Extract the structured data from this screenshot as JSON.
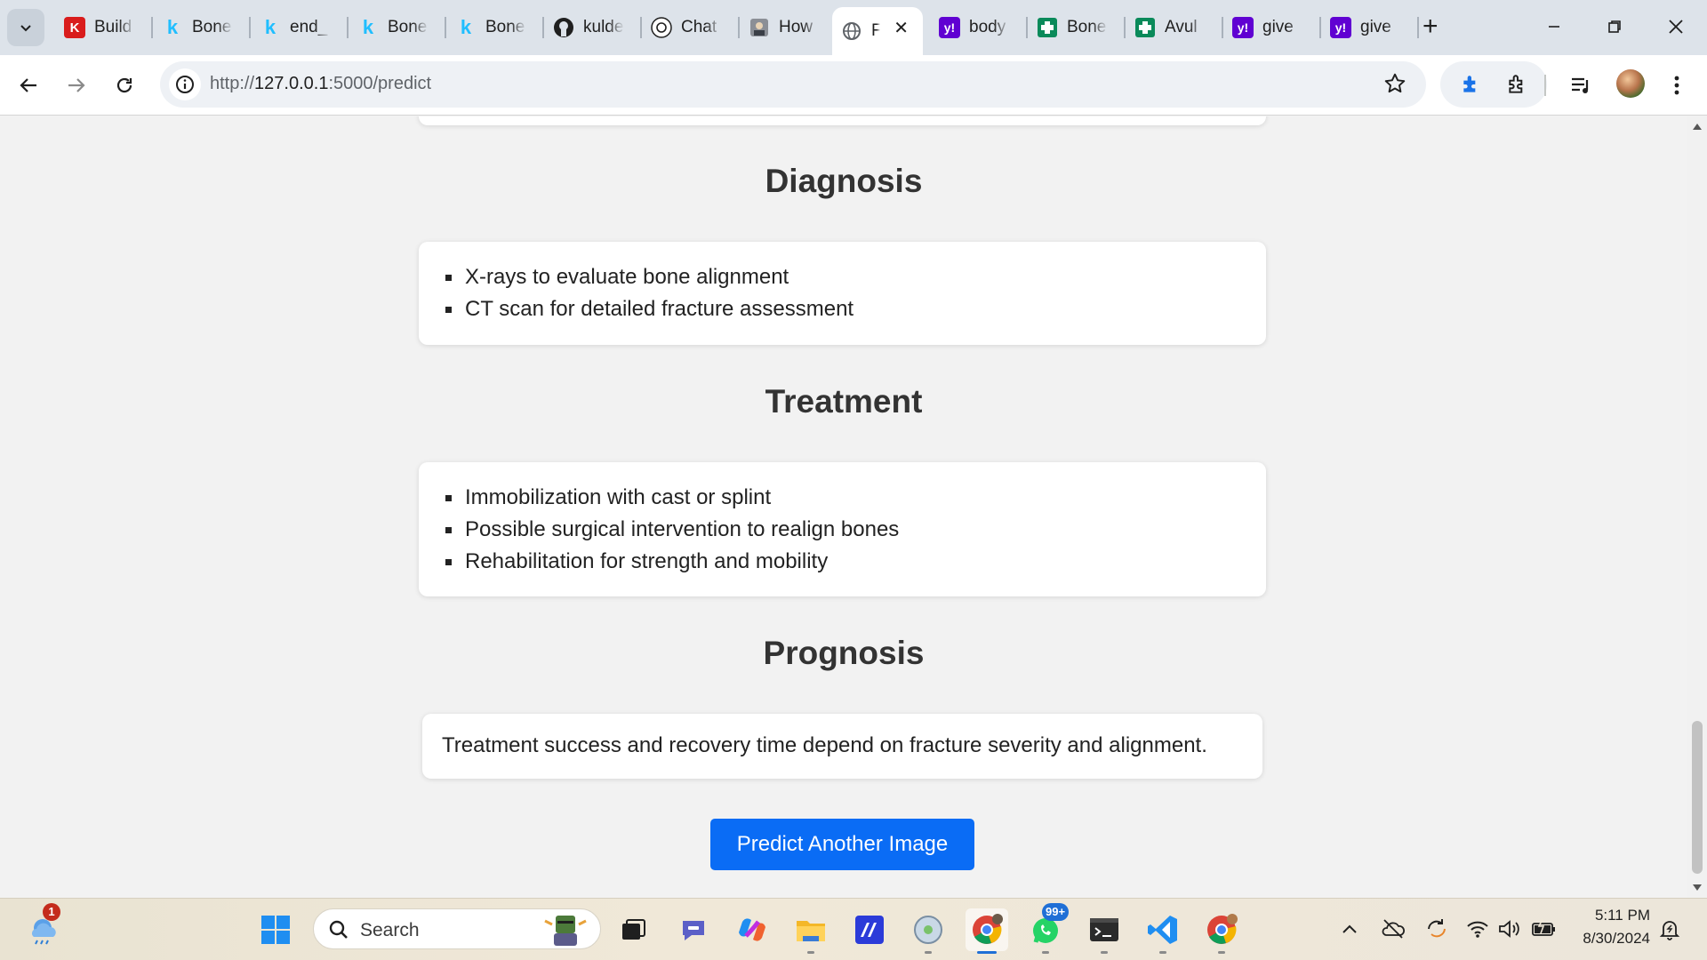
{
  "browser": {
    "tabs": [
      {
        "label": "Build",
        "icon": "k-red-icon"
      },
      {
        "label": "Bone",
        "icon": "kaggle-icon"
      },
      {
        "label": "end_",
        "icon": "kaggle-icon"
      },
      {
        "label": "Bone",
        "icon": "kaggle-icon"
      },
      {
        "label": "Bone",
        "icon": "kaggle-icon"
      },
      {
        "label": "kulde",
        "icon": "github-icon"
      },
      {
        "label": "Chat",
        "icon": "chatgpt-icon"
      },
      {
        "label": "How",
        "icon": "person-icon"
      },
      {
        "label": "F",
        "icon": "globe-icon",
        "active": true
      },
      {
        "label": "body",
        "icon": "yahoo-icon"
      },
      {
        "label": "Bone",
        "icon": "health-cross-icon"
      },
      {
        "label": "Avul",
        "icon": "health-cross-icon"
      },
      {
        "label": "give",
        "icon": "yahoo-icon"
      },
      {
        "label": "give",
        "icon": "yahoo-icon"
      }
    ],
    "new_tab_symbol": "+",
    "address": {
      "scheme": "http://",
      "host": "127.0.0.1",
      "rest": ":5000/predict"
    }
  },
  "page": {
    "diagnosis": {
      "title": "Diagnosis",
      "items": [
        "X-rays to evaluate bone alignment",
        "CT scan for detailed fracture assessment"
      ]
    },
    "treatment": {
      "title": "Treatment",
      "items": [
        "Immobilization with cast or splint",
        "Possible surgical intervention to realign bones",
        "Rehabilitation for strength and mobility"
      ]
    },
    "prognosis": {
      "title": "Prognosis",
      "text": "Treatment success and recovery time depend on fracture severity and alignment."
    },
    "predict_button": "Predict Another Image"
  },
  "taskbar": {
    "search_label": "Search",
    "weather_badge": "1",
    "whatsapp_badge": "99+",
    "time": "5:11 PM",
    "date": "8/30/2024"
  },
  "colors": {
    "accent_button": "#0a6cf5",
    "page_bg": "#f2f2f2"
  }
}
